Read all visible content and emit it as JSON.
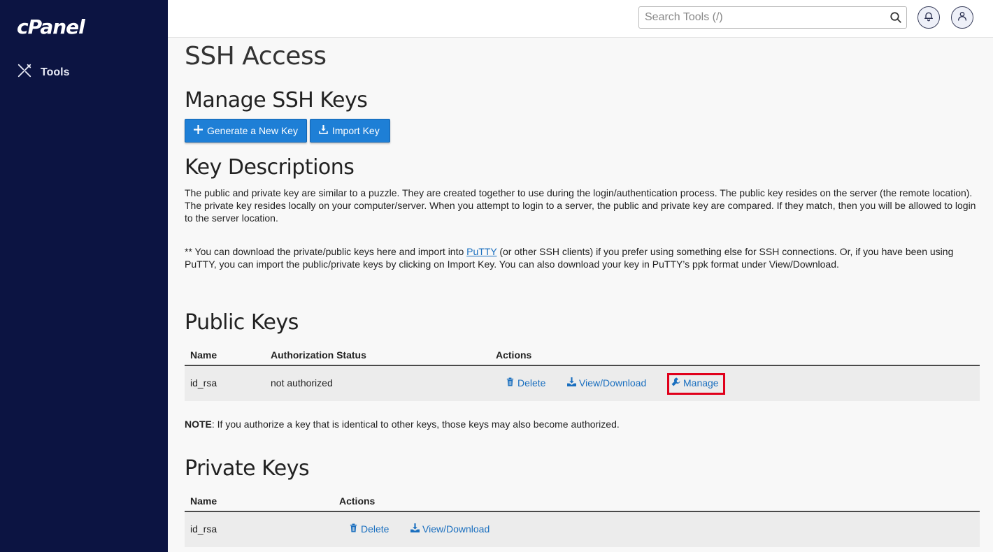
{
  "app": {
    "logo": "cPanel"
  },
  "sidebar": {
    "items": [
      {
        "label": "Tools",
        "icon": "tools-icon"
      }
    ]
  },
  "topbar": {
    "search_placeholder": "Search Tools (/)",
    "icons": [
      "search-icon",
      "bell-icon",
      "user-icon"
    ]
  },
  "page": {
    "title": "SSH Access",
    "manage_heading": "Manage SSH Keys",
    "buttons": {
      "generate": "Generate a New Key",
      "import": "Import Key"
    },
    "key_desc_heading": "Key Descriptions",
    "desc_paragraph": "The public and private key are similar to a puzzle. They are created together to use during the login/authentication process. The public key resides on the server (the remote location). The private key resides locally on your computer/server. When you attempt to login to a server, the public and private key are compared. If they match, then you will be allowed to login to the server location.",
    "putty": {
      "before": "** You can download the private/public keys here and import into ",
      "link": "PuTTY",
      "after": " (or other SSH clients) if you prefer using something else for SSH connections. Or, if you have been using PuTTY, you can import the public/private keys by clicking on Import Key. You can also download your key in PuTTY’s ppk format under View/Download."
    }
  },
  "public_keys": {
    "heading": "Public Keys",
    "columns": [
      "Name",
      "Authorization Status",
      "Actions"
    ],
    "rows": [
      {
        "name": "id_rsa",
        "status": "not authorized",
        "actions": [
          "Delete",
          "View/Download",
          "Manage"
        ]
      }
    ],
    "note_label": "NOTE",
    "note_text": ": If you authorize a key that is identical to other keys, those keys may also become authorized."
  },
  "private_keys": {
    "heading": "Private Keys",
    "columns": [
      "Name",
      "Actions"
    ],
    "rows": [
      {
        "name": "id_rsa",
        "actions": [
          "Delete",
          "View/Download"
        ]
      }
    ]
  },
  "colors": {
    "sidebar_bg": "#0c1442",
    "primary_button": "#1e7fd6",
    "link": "#1a6fbf",
    "highlight": "#e0001b"
  }
}
